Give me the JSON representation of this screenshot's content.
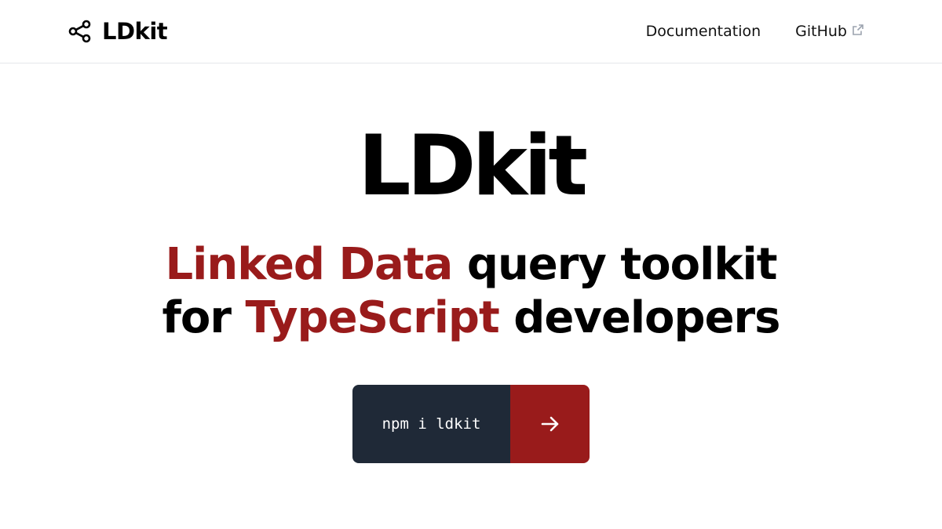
{
  "header": {
    "brand": {
      "name": "LDkit",
      "icon": "share-nodes-icon"
    },
    "nav": [
      {
        "label": "Documentation"
      },
      {
        "label": "GitHub",
        "icon": "external-link-icon"
      }
    ]
  },
  "hero": {
    "title": "LDkit",
    "tagline": {
      "accent1": "Linked Data",
      "plain1": " query toolkit",
      "plain2": "for ",
      "accent2": "TypeScript",
      "plain3": " developers"
    }
  },
  "install": {
    "command": "npm i ldkit",
    "button_icon": "arrow-right-icon"
  },
  "colors": {
    "accent": "#991b1b",
    "dark": "#1f2937",
    "text": "#000000",
    "background": "#ffffff"
  }
}
